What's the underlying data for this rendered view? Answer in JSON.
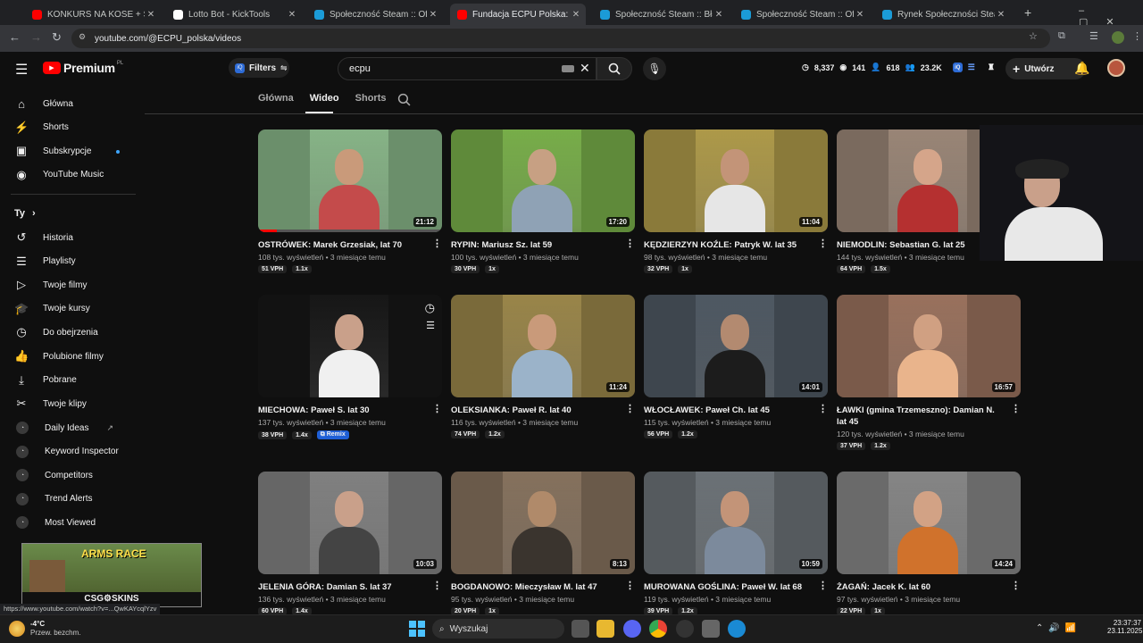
{
  "tabs": [
    {
      "label": "KONKURS NA KOSE + SKIN",
      "color": "#ff0000",
      "active": false
    },
    {
      "label": "Lotto Bot - KickTools",
      "color": "#ffffff",
      "active": false
    },
    {
      "label": "Społeczność Steam :: Oferty wy",
      "color": "#1b9bd7",
      "active": false
    },
    {
      "label": "Fundacja ECPU Polska: Łowcy P",
      "color": "#ff0000",
      "active": true
    },
    {
      "label": "Społeczność Steam :: Błąd",
      "color": "#1b9bd7",
      "active": false
    },
    {
      "label": "Społeczność Steam :: Oferty wy",
      "color": "#1b9bd7",
      "active": false
    },
    {
      "label": "Rynek Społeczności Steam :: O",
      "color": "#1b9bd7",
      "active": false
    }
  ],
  "browser": {
    "url": "youtube.com/@ECPU_polska/videos",
    "new_tab": "+"
  },
  "header": {
    "logo_text": "Premium",
    "logo_region": "PL",
    "filters_label": "Filters",
    "search_value": "ecpu",
    "stats": [
      "8,337",
      "141",
      "618",
      "23.2K"
    ],
    "create_label": "Utwórz"
  },
  "channel_tabs": [
    "Główna",
    "Wideo",
    "Shorts"
  ],
  "sidebar": {
    "main": [
      {
        "label": "Główna",
        "icon": "home-icon",
        "glyph": "⌂"
      },
      {
        "label": "Shorts",
        "icon": "shorts-icon",
        "glyph": "⚡"
      },
      {
        "label": "Subskrypcje",
        "icon": "subscriptions-icon",
        "glyph": "▣"
      },
      {
        "label": "YouTube Music",
        "icon": "music-icon",
        "glyph": "◉"
      }
    ],
    "you_header": "Ty",
    "you": [
      {
        "label": "Historia",
        "icon": "history-icon",
        "glyph": "↺"
      },
      {
        "label": "Playlisty",
        "icon": "playlist-icon",
        "glyph": "☰"
      },
      {
        "label": "Twoje filmy",
        "icon": "your-videos-icon",
        "glyph": "▷"
      },
      {
        "label": "Twoje kursy",
        "icon": "courses-icon",
        "glyph": "🎓"
      },
      {
        "label": "Do obejrzenia",
        "icon": "watch-later-icon",
        "glyph": "◷"
      },
      {
        "label": "Polubione filmy",
        "icon": "like-icon",
        "glyph": "👍"
      },
      {
        "label": "Pobrane",
        "icon": "download-icon",
        "glyph": "⤓"
      },
      {
        "label": "Twoje klipy",
        "icon": "scissors-icon",
        "glyph": "✂"
      }
    ],
    "tools": [
      "Daily Ideas",
      "Keyword Inspector",
      "Competitors",
      "Trend Alerts",
      "Most Viewed"
    ],
    "ad_title": "ARMS RACE",
    "ad_brand": "CSG⚙SKINS"
  },
  "videos": [
    {
      "title": "OSTRÓWEK: Marek Grzesiak, lat 70",
      "meta": "108 tys. wyświetleń • 3 miesiące temu",
      "duration": "21:12",
      "vph": "51 VPH",
      "mult": "1.1x",
      "bg": "#6b8f6b",
      "skin": "#c99a7a",
      "shirt": "#c44b4b"
    },
    {
      "title": "RYPIN: Mariusz Sz. lat 59",
      "meta": "100 tys. wyświetleń • 3 miesiące temu",
      "duration": "17:20",
      "vph": "30 VPH",
      "mult": "1x",
      "bg": "#5f8a3a",
      "skin": "#c7a083",
      "shirt": "#8fa2b5"
    },
    {
      "title": "KĘDZIERZYN KOŹLE: Patryk W. lat 35",
      "meta": "98 tys. wyświetleń • 3 miesiące temu",
      "duration": "11:04",
      "vph": "32 VPH",
      "mult": "1x",
      "bg": "#8a7a3a",
      "skin": "#c39478",
      "shirt": "#e6e6e6"
    },
    {
      "title": "NIEMODLIN: Sebastian G. lat 25",
      "meta": "144 tys. wyświetleń • 3 miesiące temu",
      "duration": "",
      "vph": "64 VPH",
      "mult": "1.5x",
      "bg": "#7a6a5e",
      "skin": "#d5a58a",
      "shirt": "#b53030"
    },
    {
      "title": "MIECHOWA: Paweł S. lat 30",
      "meta": "137 tys. wyświetleń • 3 miesiące temu",
      "duration": "",
      "vph": "38 VPH",
      "mult": "1.4x",
      "remix": "Remix",
      "bg": "#121212",
      "skin": "#c9a08a",
      "shirt": "#f0f0f0"
    },
    {
      "title": "OLEKSIANKA: Paweł R. lat 40",
      "meta": "116 tys. wyświetleń • 3 miesiące temu",
      "duration": "11:24",
      "vph": "74 VPH",
      "mult": "1.2x",
      "bg": "#7a6a3a",
      "skin": "#c99a7a",
      "shirt": "#9bb3c9"
    },
    {
      "title": "WŁOCŁAWEK: Paweł Ch. lat 45",
      "meta": "115 tys. wyświetleń • 3 miesiące temu",
      "duration": "14:01",
      "vph": "56 VPH",
      "mult": "1.2x",
      "bg": "#3e464e",
      "skin": "#b38a70",
      "shirt": "#1c1c1c"
    },
    {
      "title": "ŁAWKI (gmina Trzemeszno): Damian N. lat 45",
      "meta": "120 tys. wyświetleń • 3 miesiące temu",
      "duration": "16:57",
      "vph": "37 VPH",
      "mult": "1.2x",
      "bg": "#7a5a4a",
      "skin": "#d0a082",
      "shirt": "#e9b48c"
    },
    {
      "title": "JELENIA GÓRA: Damian S. lat 37",
      "meta": "136 tys. wyświetleń • 3 miesiące temu",
      "duration": "10:03",
      "vph": "60 VPH",
      "mult": "1.4x",
      "bg": "#666666",
      "skin": "#c9a08a",
      "shirt": "#444444"
    },
    {
      "title": "BOGDANOWO: Mieczysław M. lat 47",
      "meta": "95 tys. wyświetleń • 3 miesiące temu",
      "duration": "8:13",
      "vph": "20 VPH",
      "mult": "1x",
      "bg": "#6a5a4a",
      "skin": "#b08a6a",
      "shirt": "#3a342e"
    },
    {
      "title": "MUROWANA GOŚLINA: Paweł W. lat 68",
      "meta": "119 tys. wyświetleń • 3 miesiące temu",
      "duration": "10:59",
      "vph": "39 VPH",
      "mult": "1.2x",
      "bg": "#555a5e",
      "skin": "#c39478",
      "shirt": "#7c8a9c"
    },
    {
      "title": "ŻAGAŃ: Jacek K. lat 60",
      "meta": "97 tys. wyświetleń • 3 miesiące temu",
      "duration": "14:24",
      "vph": "22 VPH",
      "mult": "1x",
      "bg": "#6a6a6a",
      "skin": "#d2a285",
      "shirt": "#d0722c"
    }
  ],
  "status_url": "https://www.youtube.com/watch?v=...QwKAYcqlYzv",
  "taskbar": {
    "weather_temp": "-4°C",
    "weather_desc": "Przew. bezchm.",
    "search_placeholder": "Wyszukaj",
    "time": "23:37:37",
    "date": "23.11.2025"
  }
}
